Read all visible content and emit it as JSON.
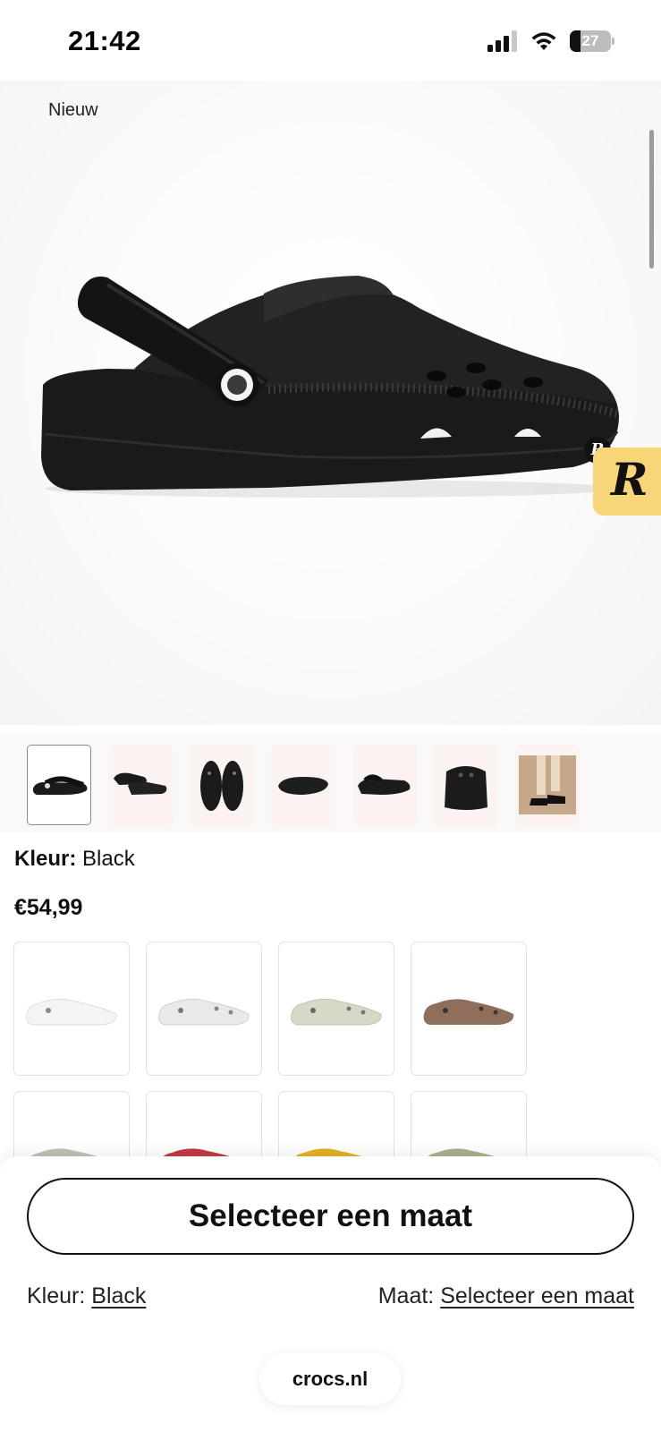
{
  "status_bar": {
    "time": "21:42",
    "battery_level": "27"
  },
  "product": {
    "badge": "Nieuw",
    "color_label": "Kleur:",
    "color_value": "Black",
    "price": "€54,99"
  },
  "colors": {
    "brand_badge_bg": "#f7d679",
    "swatches": [
      "#f4f4f4",
      "#e9e9ea",
      "#d8d8c6",
      "#8f6f5c",
      "#bfc1b6",
      "#c23a40",
      "#e3b126",
      "#a9b08c"
    ]
  },
  "bottom_bar": {
    "size_button_label": "Selecteer een maat",
    "color_prefix": "Kleur:",
    "color_value": "Black",
    "size_prefix": "Maat:",
    "size_value": "Selecteer een maat",
    "url": "crocs.nl"
  }
}
